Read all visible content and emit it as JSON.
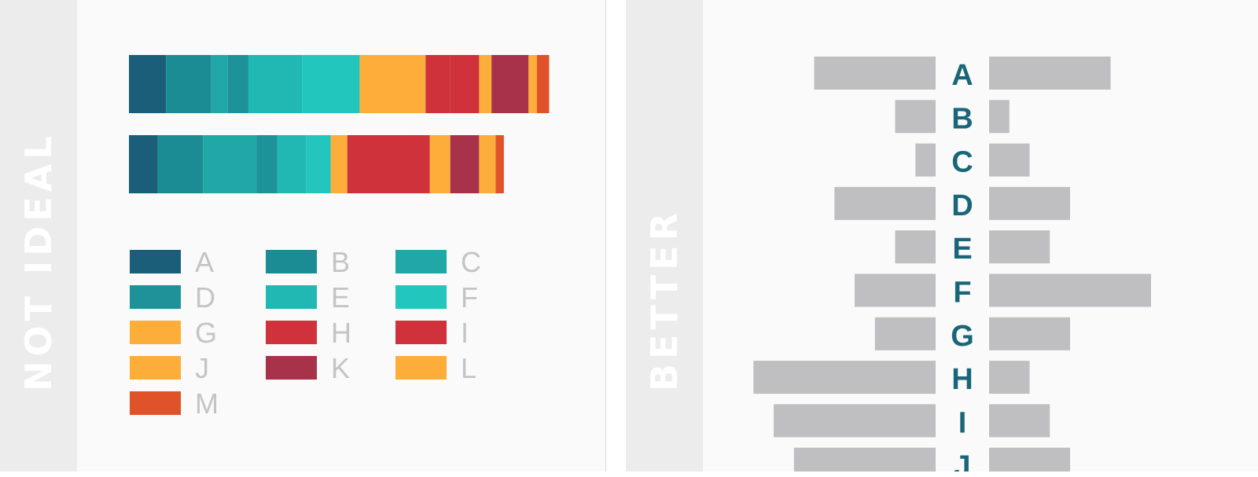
{
  "left_panel": {
    "label": "NOT IDEAL"
  },
  "right_panel": {
    "label": "BETTER"
  },
  "colors": {
    "A": "#1a5e7a",
    "B": "#1b8c94",
    "C": "#1fa8a6",
    "D": "#1d9299",
    "E": "#21b8b3",
    "F": "#22c6bd",
    "G": "#fdae3a",
    "H": "#cf323a",
    "I": "#cf323a",
    "J": "#fdae3a",
    "K": "#a8324a",
    "L": "#fdae3a",
    "M": "#e0532a",
    "legend_text": "#c4c4c4",
    "bar_gray": "#bfbfc1",
    "letter_teal": "#1a6678"
  },
  "chart_data": [
    {
      "type": "bar",
      "orientation": "horizontal-stacked",
      "title": "",
      "categories": [
        "A",
        "B",
        "C",
        "D",
        "E",
        "F",
        "G",
        "H",
        "I",
        "J",
        "K",
        "L",
        "M"
      ],
      "series": [
        {
          "values": [
            9,
            11,
            4,
            5,
            13,
            14,
            16,
            6,
            7,
            3,
            9,
            2,
            3
          ]
        },
        {
          "values": [
            7,
            11,
            13,
            5,
            7,
            6,
            4,
            20,
            0,
            5,
            7,
            4,
            2
          ]
        }
      ],
      "legend": {
        "entries": [
          "A",
          "B",
          "C",
          "D",
          "E",
          "F",
          "G",
          "H",
          "I",
          "J",
          "K",
          "L",
          "M"
        ],
        "placement": "bottom",
        "columns": 3
      }
    },
    {
      "type": "bar",
      "orientation": "horizontal-diverging",
      "title": "",
      "categories": [
        "A",
        "B",
        "C",
        "D",
        "E",
        "F",
        "G",
        "H",
        "I",
        "J"
      ],
      "series": [
        {
          "values": [
            30,
            10,
            5,
            25,
            10,
            20,
            15,
            45,
            40,
            35
          ]
        },
        {
          "values": [
            30,
            5,
            10,
            20,
            15,
            40,
            20,
            10,
            15,
            20
          ]
        }
      ]
    }
  ]
}
